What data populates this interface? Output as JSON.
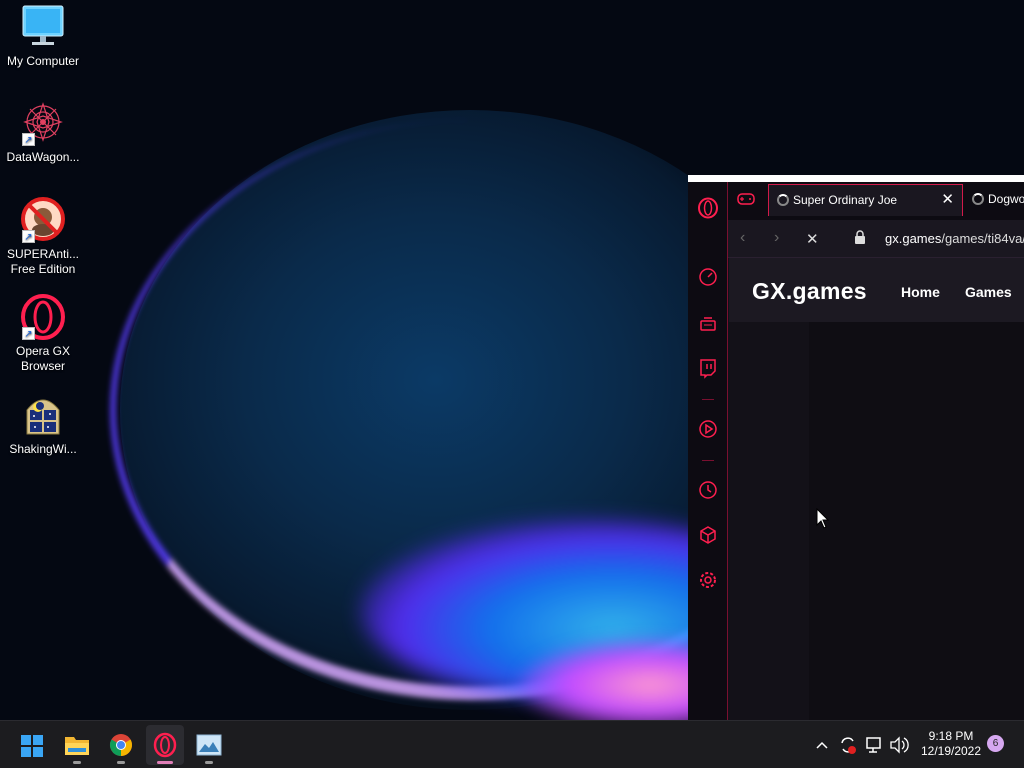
{
  "desktop": {
    "icons": [
      {
        "label": "My Computer",
        "icon": "monitor-icon"
      },
      {
        "label": "DataWagon...",
        "icon": "datawagon-icon"
      },
      {
        "label": "SUPERAnti...",
        "label2": "Free Edition",
        "icon": "superantispyware-icon"
      },
      {
        "label": "Opera GX",
        "label2": "Browser",
        "icon": "opera-gx-icon"
      },
      {
        "label": "ShakingWi...",
        "icon": "shaking-window-icon"
      }
    ]
  },
  "browser": {
    "accent": "#ff1f4f",
    "tabs": [
      {
        "title": "Super Ordinary Joe",
        "loading": true,
        "active": true
      },
      {
        "title": "Dogwo",
        "loading": true,
        "active": false
      }
    ],
    "address": {
      "domain": "gx.games",
      "path": "/games/ti84va/"
    },
    "site": {
      "logo": "GX.games",
      "nav": [
        "Home",
        "Games"
      ]
    },
    "sidebar_icons": [
      "opera-icon",
      "speedometer-icon",
      "game-controller-icon",
      "twitch-icon",
      "player-icon",
      "history-icon",
      "box-icon",
      "settings-icon"
    ]
  },
  "taskbar": {
    "apps": [
      "start-icon",
      "file-explorer-icon",
      "chrome-icon",
      "opera-gx-icon",
      "photos-icon"
    ],
    "clock": {
      "time": "9:18 PM",
      "date": "12/19/2022"
    },
    "notifications": "6"
  }
}
